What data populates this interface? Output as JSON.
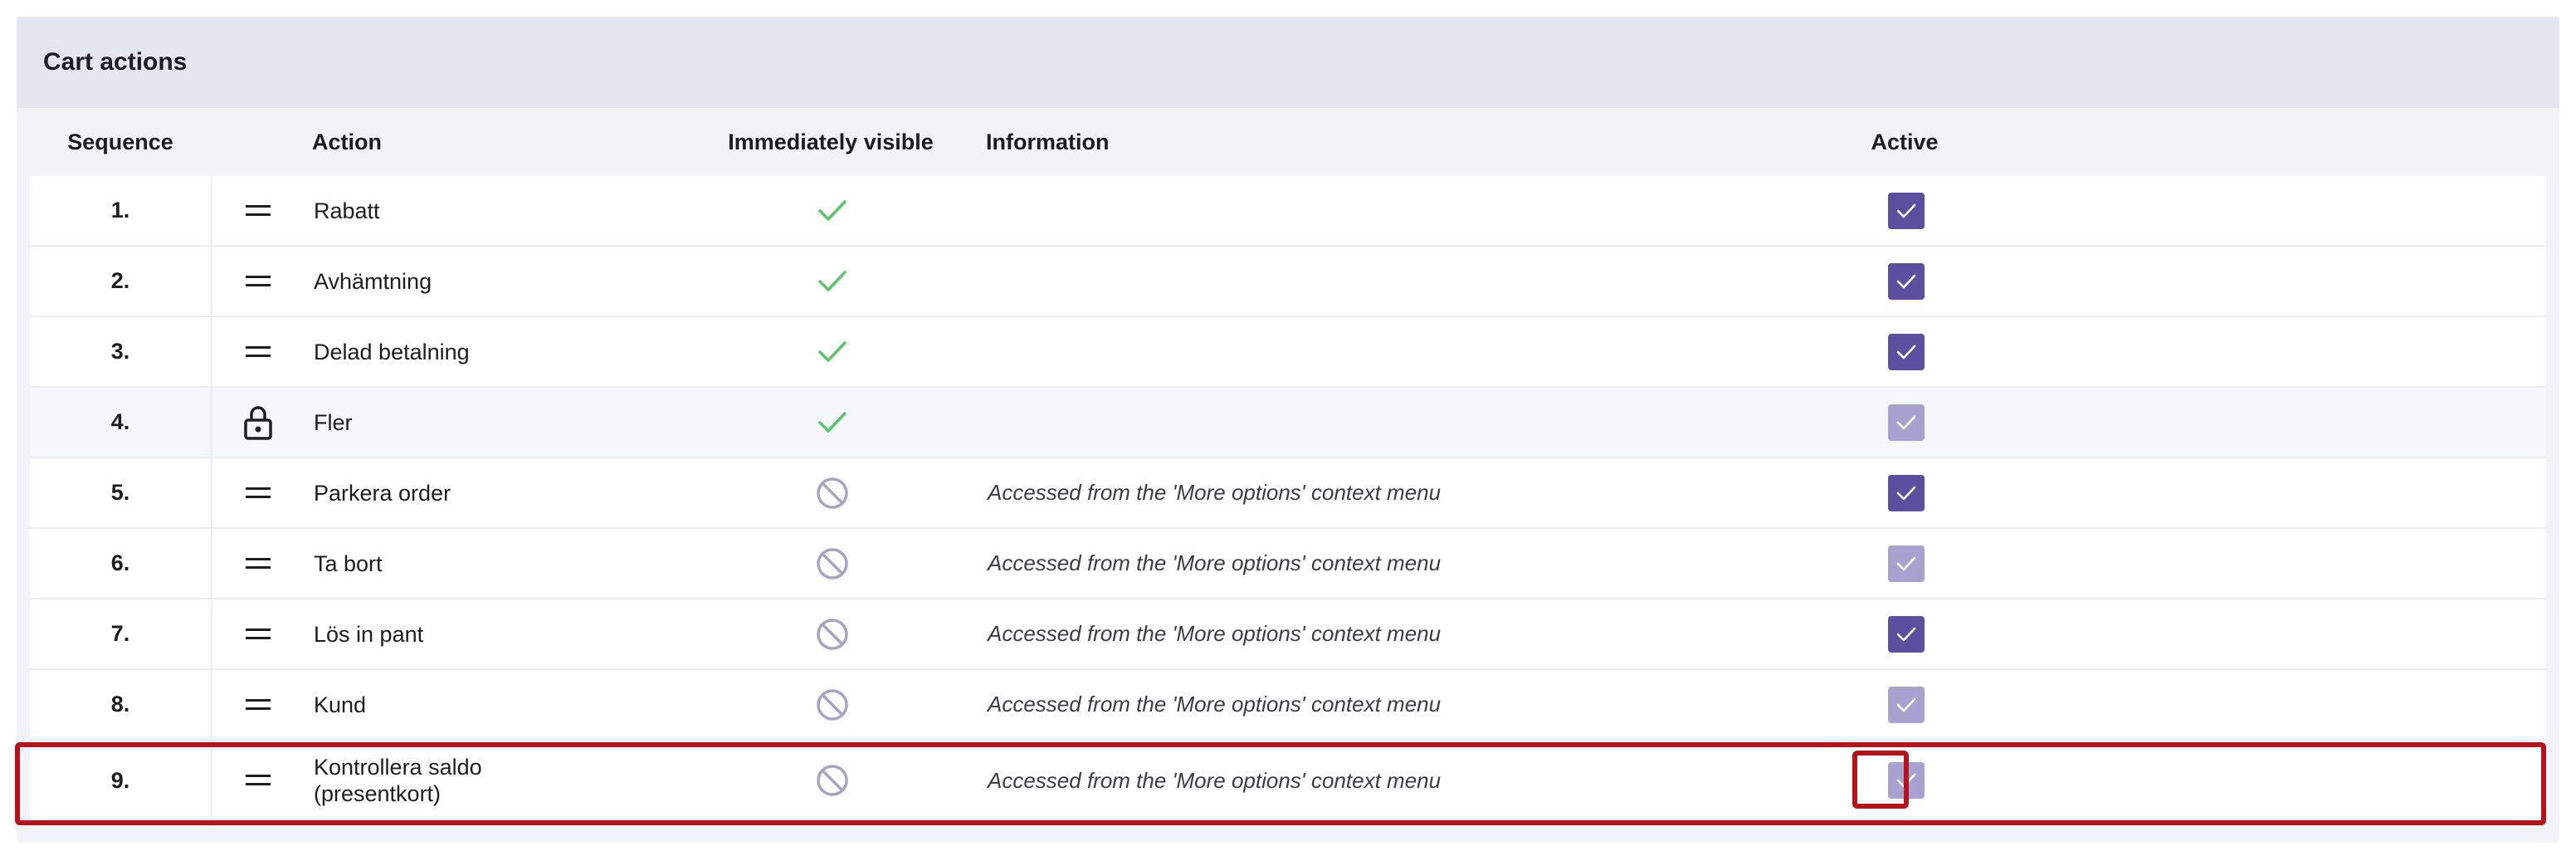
{
  "panel": {
    "title": "Cart actions"
  },
  "columns": {
    "sequence": "Sequence",
    "action": "Action",
    "immediately_visible": "Immediately visible",
    "information": "Information",
    "active": "Active"
  },
  "rows": [
    {
      "seq": "1.",
      "action": "Rabatt",
      "handle": "drag-handle-icon",
      "visible": true,
      "info": "",
      "active": true,
      "active_disabled": false
    },
    {
      "seq": "2.",
      "action": "Avhämtning",
      "handle": "drag-handle-icon",
      "visible": true,
      "info": "",
      "active": true,
      "active_disabled": false
    },
    {
      "seq": "3.",
      "action": "Delad betalning",
      "handle": "drag-handle-icon",
      "visible": true,
      "info": "",
      "active": true,
      "active_disabled": false
    },
    {
      "seq": "4.",
      "action": "Fler",
      "handle": "lock-icon",
      "visible": true,
      "info": "",
      "active": true,
      "active_disabled": true
    },
    {
      "seq": "5.",
      "action": "Parkera order",
      "handle": "drag-handle-icon",
      "visible": false,
      "info": "Accessed from the 'More options' context menu",
      "active": true,
      "active_disabled": false
    },
    {
      "seq": "6.",
      "action": "Ta bort",
      "handle": "drag-handle-icon",
      "visible": false,
      "info": "Accessed from the 'More options' context menu",
      "active": true,
      "active_disabled": true
    },
    {
      "seq": "7.",
      "action": "Lös in pant",
      "handle": "drag-handle-icon",
      "visible": false,
      "info": "Accessed from the 'More options' context menu",
      "active": true,
      "active_disabled": false
    },
    {
      "seq": "8.",
      "action": "Kund",
      "handle": "drag-handle-icon",
      "visible": false,
      "info": "Accessed from the 'More options' context menu",
      "active": true,
      "active_disabled": true
    },
    {
      "seq": "9.",
      "action": "Kontrollera saldo (presentkort)",
      "action_line1": "Kontrollera saldo",
      "action_line2": "(presentkort)",
      "handle": "drag-handle-icon",
      "visible": false,
      "info": "Accessed from the 'More options' context menu",
      "active": true,
      "active_disabled": true
    }
  ],
  "colors": {
    "checkbox_on": "#5c4fa0",
    "checkbox_disabled": "#a9a2d0",
    "check_visible": "#5cc26c",
    "not_visible": "#a3a5c2",
    "highlight": "#b5121b"
  }
}
